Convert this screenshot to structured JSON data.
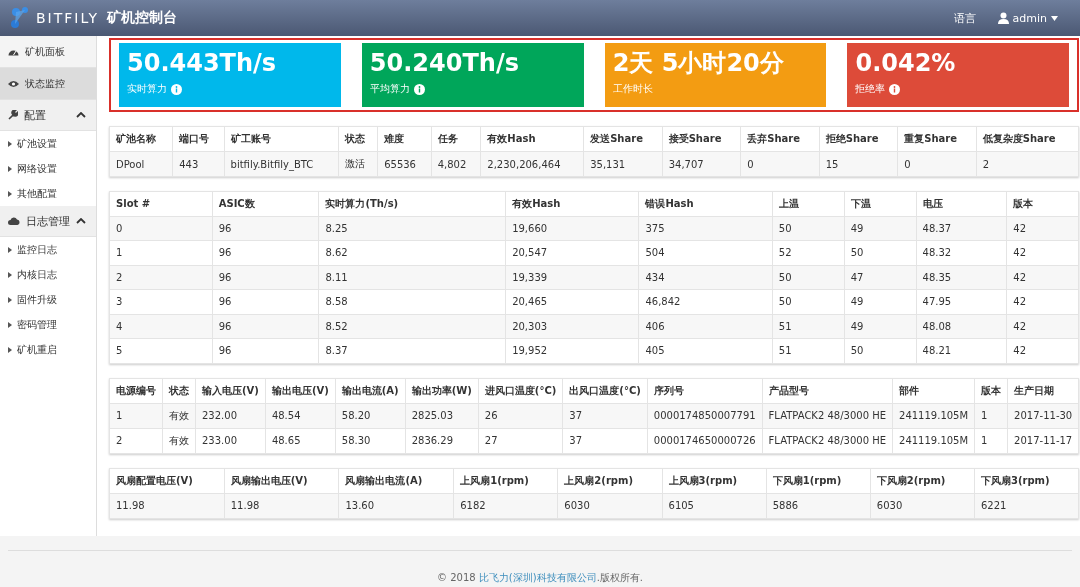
{
  "header": {
    "logo": "BITFILY",
    "title": "矿机控制台",
    "language": "语言",
    "user": "admin"
  },
  "sidebar": [
    {
      "kind": "link",
      "label": "矿机面板",
      "selected": false
    },
    {
      "kind": "link",
      "label": "状态监控",
      "selected": true
    },
    {
      "kind": "group",
      "label": "配置",
      "expanded": true,
      "children": [
        {
          "label": "矿池设置",
          "selected": false
        },
        {
          "label": "网络设置",
          "selected": false
        },
        {
          "label": "其他配置",
          "selected": false
        }
      ]
    },
    {
      "kind": "group",
      "label": "日志管理",
      "expanded": true,
      "children": [
        {
          "label": "监控日志",
          "selected": false
        },
        {
          "label": "内核日志",
          "selected": false
        },
        {
          "label": "固件升级",
          "selected": false
        },
        {
          "label": "密码管理",
          "selected": false
        },
        {
          "label": "矿机重启",
          "selected": false
        }
      ]
    }
  ],
  "stats": [
    {
      "value": "50.443Th/s",
      "label": "实时算力",
      "info": true,
      "color": "#00b8eb"
    },
    {
      "value": "50.240Th/s",
      "label": "平均算力",
      "info": true,
      "color": "#00a65a"
    },
    {
      "value": "2天 5小时20分",
      "label": "工作时长",
      "info": false,
      "color": "#f39c12"
    },
    {
      "value": "0.042%",
      "label": "拒绝率",
      "info": true,
      "color": "#dd4b39"
    }
  ],
  "tables": [
    {
      "columns": [
        "矿池名称",
        "端口号",
        "矿工账号",
        "状态",
        "难度",
        "任务",
        "有效Hash",
        "发送Share",
        "接受Share",
        "丢弃Share",
        "拒绝Share",
        "重复Share",
        "低复杂度Share"
      ],
      "rows": [
        [
          "DPool",
          "443",
          "bitfily.Bitfily_BTC",
          "激活",
          "65536",
          "4,802",
          "2,230,206,464",
          "35,131",
          "34,707",
          "0",
          "15",
          "0",
          "2"
        ]
      ]
    },
    {
      "columns": [
        "Slot #",
        "ASIC数",
        "实时算力(Th/s)",
        "有效Hash",
        "错误Hash",
        "上温",
        "下温",
        "电压",
        "版本"
      ],
      "rows": [
        [
          "0",
          "96",
          "8.25",
          "19,660",
          "375",
          "50",
          "49",
          "48.37",
          "42"
        ],
        [
          "1",
          "96",
          "8.62",
          "20,547",
          "504",
          "52",
          "50",
          "48.32",
          "42"
        ],
        [
          "2",
          "96",
          "8.11",
          "19,339",
          "434",
          "50",
          "47",
          "48.35",
          "42"
        ],
        [
          "3",
          "96",
          "8.58",
          "20,465",
          "46,842",
          "50",
          "49",
          "47.95",
          "42"
        ],
        [
          "4",
          "96",
          "8.52",
          "20,303",
          "406",
          "51",
          "49",
          "48.08",
          "42"
        ],
        [
          "5",
          "96",
          "8.37",
          "19,952",
          "405",
          "51",
          "50",
          "48.21",
          "42"
        ]
      ]
    },
    {
      "columns": [
        "电源编号",
        "状态",
        "输入电压(V)",
        "输出电压(V)",
        "输出电流(A)",
        "输出功率(W)",
        "进风口温度(°C)",
        "出风口温度(°C)",
        "序列号",
        "产品型号",
        "部件",
        "版本",
        "生产日期"
      ],
      "rows": [
        [
          "1",
          "有效",
          "232.00",
          "48.54",
          "58.20",
          "2825.03",
          "26",
          "37",
          "0000174850007791",
          "FLATPACK2 48/3000 HE",
          "241119.105M",
          "1",
          "2017-11-30"
        ],
        [
          "2",
          "有效",
          "233.00",
          "48.65",
          "58.30",
          "2836.29",
          "27",
          "37",
          "0000174650000726",
          "FLATPACK2 48/3000 HE",
          "241119.105M",
          "1",
          "2017-11-17"
        ]
      ]
    },
    {
      "columns": [
        "风扇配置电压(V)",
        "风扇输出电压(V)",
        "风扇输出电流(A)",
        "上风扇1(rpm)",
        "上风扇2(rpm)",
        "上风扇3(rpm)",
        "下风扇1(rpm)",
        "下风扇2(rpm)",
        "下风扇3(rpm)"
      ],
      "rows": [
        [
          "11.98",
          "11.98",
          "13.60",
          "6182",
          "6030",
          "6105",
          "5886",
          "6030",
          "6221"
        ]
      ]
    }
  ],
  "footer": {
    "prefix": "© 2018 ",
    "company": "比飞力(深圳)科技有限公司",
    "suffix": ".版权所有."
  }
}
